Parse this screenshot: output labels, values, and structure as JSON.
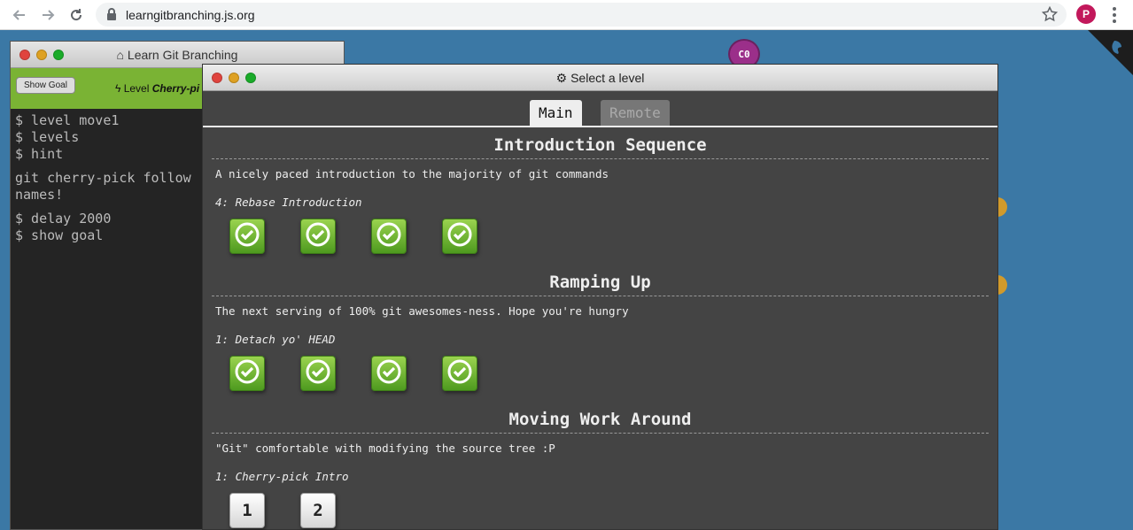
{
  "browser": {
    "url": "learngitbranching.js.org",
    "profile_initial": "P"
  },
  "graph": {
    "commit_label": "C0"
  },
  "terminal": {
    "title": "Learn Git Branching",
    "show_goal": "Show Goal",
    "level_prefix": "Level",
    "level_name": "Cherry-pi",
    "lines_a": [
      "$ level move1",
      "$ levels",
      "$ hint"
    ],
    "hint_text_1": "git cherry-pick follow",
    "hint_text_2": "names!",
    "lines_b": [
      "$ delay 2000",
      "$ show goal"
    ]
  },
  "dialog": {
    "title": "Select a level",
    "tabs": [
      "Main",
      "Remote"
    ],
    "sections": [
      {
        "title": "Introduction Sequence",
        "about": "A nicely paced introduction to the majority of git commands",
        "current": "4: Rebase Introduction",
        "levels": [
          "done",
          "done",
          "done",
          "done"
        ]
      },
      {
        "title": "Ramping Up",
        "about": "The next serving of 100% git awesomes-ness. Hope you're hungry",
        "current": "1: Detach yo' HEAD",
        "levels": [
          "done",
          "done",
          "done",
          "done"
        ]
      },
      {
        "title": "Moving Work Around",
        "about": "\"Git\" comfortable with modifying the source tree :P",
        "current": "1: Cherry-pick Intro",
        "levels": [
          "1",
          "2"
        ]
      }
    ]
  },
  "colors": {
    "background": "#3b78a5",
    "terminal_accent": "#7ab334",
    "commit": "#9b2f8a",
    "complete": "#6ab52e"
  }
}
